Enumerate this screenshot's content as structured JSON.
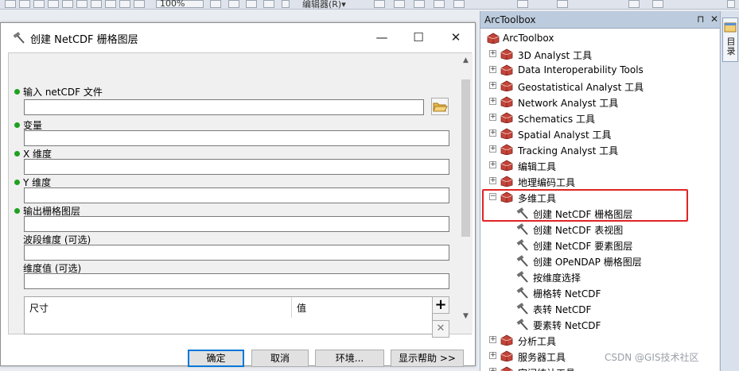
{
  "toolbar": {
    "zoom_value": "100%",
    "editor_label": "编辑器(R)▾"
  },
  "dialog": {
    "title": "创建 NetCDF 栅格图层",
    "fields": [
      {
        "label": "输入 netCDF 文件",
        "value": "",
        "required": true
      },
      {
        "label": "变量",
        "value": "",
        "required": true
      },
      {
        "label": "X 维度",
        "value": "",
        "required": true
      },
      {
        "label": "Y 维度",
        "value": "",
        "required": true
      },
      {
        "label": "输出栅格图层",
        "value": "",
        "required": true
      },
      {
        "label": "波段维度 (可选)",
        "value": "",
        "required": false
      },
      {
        "label": "维度值 (可选)",
        "value": "",
        "required": false
      }
    ],
    "dimension_table": {
      "col_dimension": "尺寸",
      "col_value": "值"
    },
    "buttons": {
      "ok": "确定",
      "cancel": "取消",
      "environments": "环境...",
      "show_help": "显示帮助 >>"
    }
  },
  "arctoolbox": {
    "panel_title": "ArcToolbox",
    "root": "ArcToolbox",
    "toolboxes": [
      "3D Analyst 工具",
      "Data Interoperability Tools",
      "Geostatistical Analyst 工具",
      "Network Analyst 工具",
      "Schematics 工具",
      "Spatial Analyst 工具",
      "Tracking Analyst 工具",
      "编辑工具",
      "地理编码工具",
      "多维工具"
    ],
    "multidim_tools": [
      "创建 NetCDF 栅格图层",
      "创建 NetCDF 表视图",
      "创建 NetCDF 要素图层",
      "创建 OPeNDAP 栅格图层",
      "按维度选择",
      "栅格转 NetCDF",
      "表转 NetCDF",
      "要素转 NetCDF"
    ],
    "toolboxes_after": [
      "分析工具",
      "服务器工具",
      "空间统计工具"
    ]
  },
  "right_strip": {
    "catalog_tab": "目录"
  },
  "watermark": "CSDN @GIS技术社区",
  "colors": {
    "required_dot": "#1fa11f",
    "highlight": "#e02424",
    "panel_header": "#bccbdd",
    "toolbox_red": "#c4443a"
  }
}
